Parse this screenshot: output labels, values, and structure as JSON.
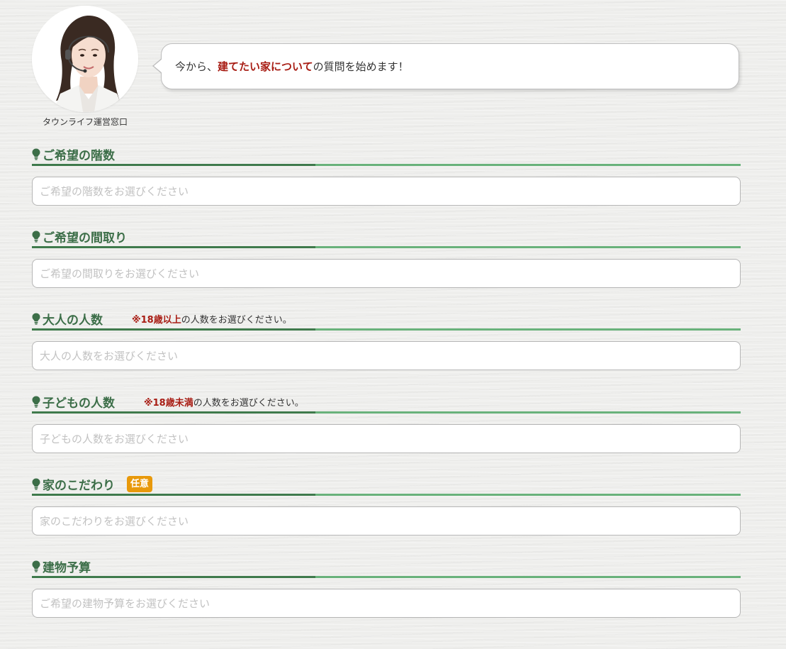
{
  "operator": {
    "caption": "タウンライフ運営窓口"
  },
  "intro": {
    "prefix": "今から、",
    "emphasis": "建てたい家について",
    "suffix": "の質問を始めます！"
  },
  "sections": [
    {
      "title": "ご希望の階数",
      "placeholder": "ご希望の階数をお選びください"
    },
    {
      "title": "ご希望の間取り",
      "placeholder": "ご希望の間取りをお選びください"
    },
    {
      "title": "大人の人数",
      "note_emph": "※18歳以上",
      "note_rest": "の人数をお選びください。",
      "placeholder": "大人の人数をお選びください"
    },
    {
      "title": "子どもの人数",
      "note_emph": "※18歳未満",
      "note_rest": "の人数をお選びください。",
      "placeholder": "子どもの人数をお選びください"
    },
    {
      "title": "家のこだわり",
      "badge": "任意",
      "placeholder": "家のこだわりをお選びください"
    },
    {
      "title": "建物予算",
      "placeholder": "ご希望の建物予算をお選びください"
    }
  ],
  "colors": {
    "heading_green": "#3c6e48",
    "rule_dark": "#3f7a4c",
    "rule_light": "#69b27b",
    "emphasis_red": "#a81d14",
    "badge_orange": "#e8990b"
  },
  "icons": {
    "section_marker": "lightbulb-icon",
    "avatar": "operator-avatar"
  }
}
